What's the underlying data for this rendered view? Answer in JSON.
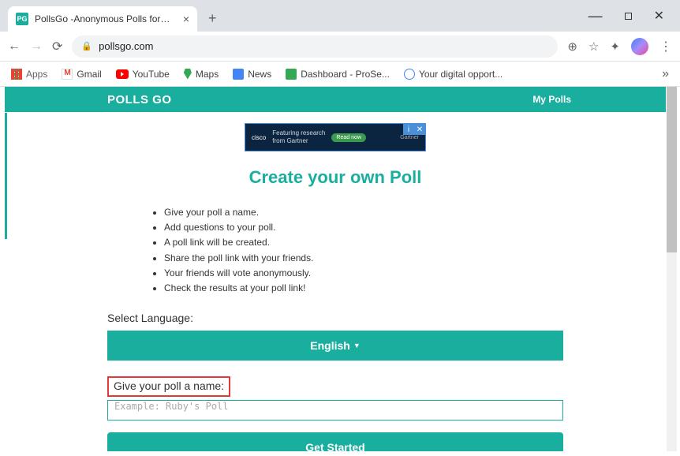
{
  "window": {
    "tab_title": "PollsGo -Anonymous Polls for W",
    "favicon_text": "PG"
  },
  "browser": {
    "url": "pollsgo.com",
    "bookmarks": {
      "apps": "Apps",
      "gmail": "Gmail",
      "youtube": "YouTube",
      "maps": "Maps",
      "news": "News",
      "dashboard": "Dashboard - ProSe...",
      "digital": "Your digital opport..."
    }
  },
  "site": {
    "logo": "POLLS GO",
    "my_polls": "My Polls"
  },
  "ad": {
    "brand": "cisco",
    "line1": "Featuring research",
    "line2": "from Gartner",
    "cta": "Read now",
    "partner": "Gartner"
  },
  "page": {
    "heading": "Create your own Poll",
    "instructions": [
      "Give your poll a name.",
      "Add questions to your poll.",
      "A poll link will be created.",
      "Share the poll link with your friends.",
      "Your friends will vote anonymously.",
      "Check the results at your poll link!"
    ],
    "select_language_label": "Select Language:",
    "language_value": "English",
    "poll_name_label": "Give your poll a name:",
    "poll_name_placeholder": "Example: Ruby's Poll",
    "get_started": "Get Started"
  }
}
